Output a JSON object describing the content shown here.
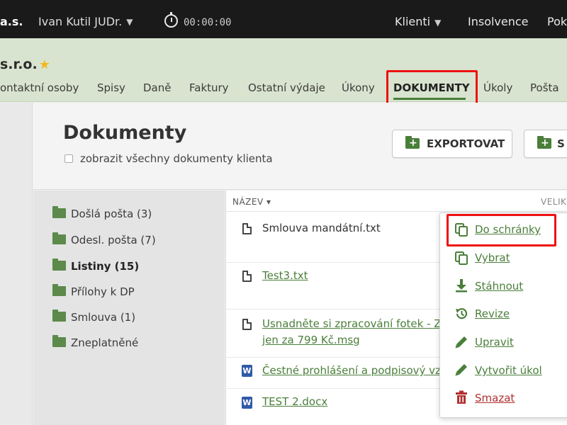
{
  "topbar": {
    "brand": "a.s.",
    "user": "Ivan Kutil JUDr.",
    "timer": "00:00:00",
    "klienti": "Klienti",
    "insolvence": "Insolvence",
    "pok": "Pok"
  },
  "client": {
    "name": "s.r.o."
  },
  "tabs": [
    {
      "label": "ontaktní osoby"
    },
    {
      "label": "Spisy"
    },
    {
      "label": "Daně"
    },
    {
      "label": "Faktury"
    },
    {
      "label": "Ostatní výdaje"
    },
    {
      "label": "Úkony"
    },
    {
      "label": "DOKUMENTY"
    },
    {
      "label": "Úkoly"
    },
    {
      "label": "Pošta"
    }
  ],
  "page": {
    "title": "Dokumenty",
    "show_all_label": "zobrazit všechny dokumenty klienta",
    "export_label": "EXPORTOVAT",
    "second_label": "S"
  },
  "folders": [
    {
      "label": "Došlá pošta (3)"
    },
    {
      "label": "Odesl. pošta (7)"
    },
    {
      "label": "Listiny (15)"
    },
    {
      "label": "Přílohy k DP"
    },
    {
      "label": "Smlouva (1)"
    },
    {
      "label": "Zneplatněné"
    }
  ],
  "files": {
    "col_name": "NÁZEV ▾",
    "col_size": "VELIK",
    "rows": [
      {
        "name": "Smlouva mandátní.txt"
      },
      {
        "name": "Test3.txt"
      },
      {
        "name_line1": "Usnadněte si zpracování fotek - Z",
        "name_line2": "jen za 799 Kč.msg"
      },
      {
        "name": "Čestné prohlášení a podpisový vz"
      },
      {
        "name": "TEST 2.docx"
      }
    ],
    "word_icon_letter": "W"
  },
  "menu": [
    {
      "label": "Do schránky",
      "icon": "copy-icon"
    },
    {
      "label": "Vybrat",
      "icon": "copy-icon"
    },
    {
      "label": "Stáhnout",
      "icon": "download-icon"
    },
    {
      "label": "Revize",
      "icon": "history-icon"
    },
    {
      "label": "Upravit",
      "icon": "pencil-icon"
    },
    {
      "label": "Vytvořit úkol",
      "icon": "pencil-icon"
    },
    {
      "label": "Smazat",
      "icon": "trash-icon"
    }
  ],
  "colors": {
    "accent_green": "#4a7f3a",
    "highlight_red": "#e11111",
    "danger": "#b03030"
  }
}
